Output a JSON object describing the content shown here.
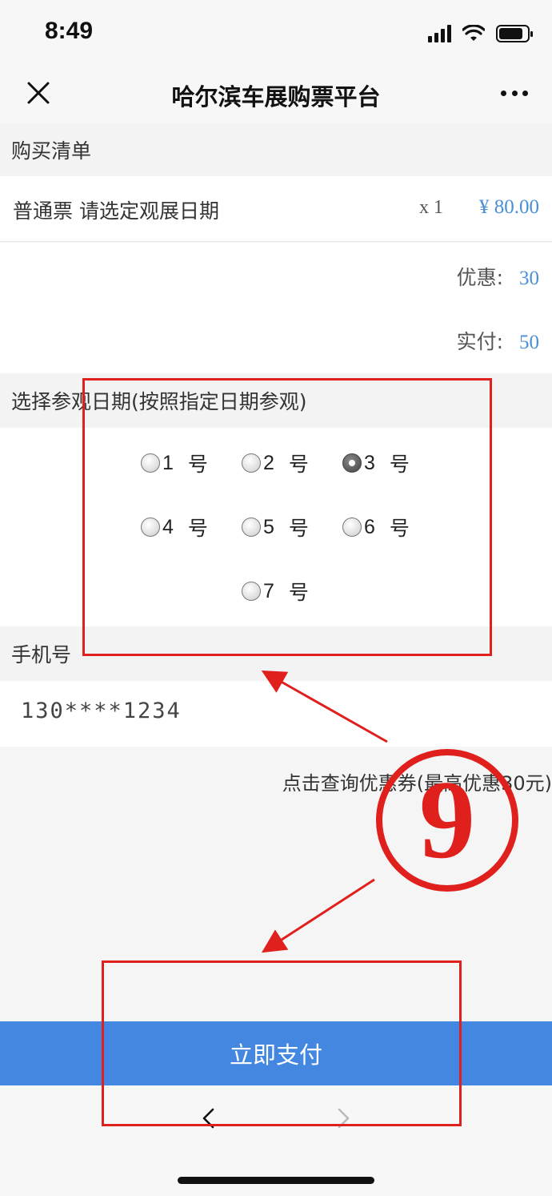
{
  "status": {
    "time": "8:49",
    "battery_level": 0.85
  },
  "nav": {
    "title": "哈尔滨车展购票平台"
  },
  "order": {
    "section_title": "购买清单",
    "item_name": "普通票 请选定观展日期",
    "item_qty": "x 1",
    "item_price": "¥ 80.00",
    "discount_label": "优惠:",
    "discount_value": "30",
    "paid_label": "实付:",
    "paid_value": "50"
  },
  "date_select": {
    "section_title": "选择参观日期(按照指定日期参观)",
    "unit": "号",
    "options": [
      {
        "num": "1",
        "checked": false
      },
      {
        "num": "2",
        "checked": false
      },
      {
        "num": "3",
        "checked": true
      },
      {
        "num": "4",
        "checked": false
      },
      {
        "num": "5",
        "checked": false
      },
      {
        "num": "6",
        "checked": false
      },
      {
        "num": "7",
        "checked": false
      }
    ]
  },
  "phone": {
    "section_title": "手机号",
    "value": "130****1234"
  },
  "coupon": {
    "link_text": "点击查询优惠券(最高优惠30元)"
  },
  "pay": {
    "button_label": "立即支付"
  },
  "annotation": {
    "step_number": "9",
    "color": "#e0201d"
  },
  "colors": {
    "accent": "#4487e0",
    "price": "#4a8fd6"
  }
}
